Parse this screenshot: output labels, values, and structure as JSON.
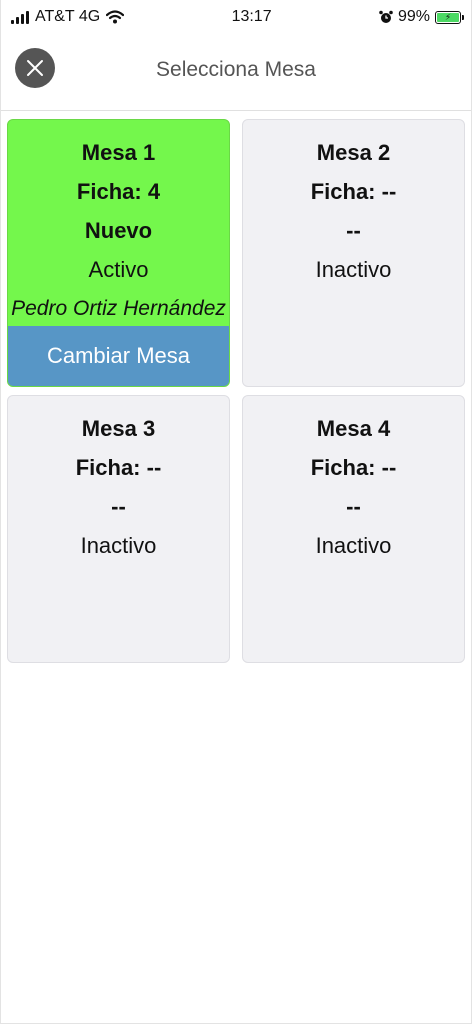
{
  "status_bar": {
    "carrier": "AT&T 4G",
    "time": "13:17",
    "battery": "99%"
  },
  "header": {
    "title": "Selecciona Mesa"
  },
  "tables": [
    {
      "name": "Mesa 1",
      "ficha": "Ficha: 4",
      "state": "Nuevo",
      "status": "Activo",
      "customer": "Pedro Ortiz Hernández",
      "action_label": "Cambiar Mesa"
    },
    {
      "name": "Mesa 2",
      "ficha": "Ficha: --",
      "state": "--",
      "status": "Inactivo"
    },
    {
      "name": "Mesa 3",
      "ficha": "Ficha: --",
      "state": "--",
      "status": "Inactivo"
    },
    {
      "name": "Mesa 4",
      "ficha": "Ficha: --",
      "state": "--",
      "status": "Inactivo"
    }
  ],
  "colors": {
    "active_card": "#74f74c",
    "inactive_card": "#f1f1f4",
    "action_button": "#5796c6"
  },
  "icons": {
    "signal": "signal-icon",
    "wifi": "wifi-icon",
    "alarm": "alarm-icon",
    "battery": "battery-icon",
    "close": "close-icon"
  }
}
